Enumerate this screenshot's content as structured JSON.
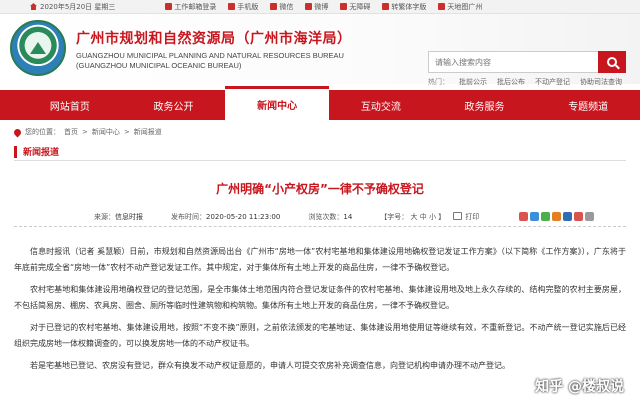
{
  "topbar": {
    "date": "2020年5月20日 星期三",
    "links": [
      {
        "label": "工作邮箱登录",
        "icon": "mail-icon"
      },
      {
        "label": "手机版",
        "icon": "mobile-icon"
      },
      {
        "label": "微信",
        "icon": "wechat-icon"
      },
      {
        "label": "微博",
        "icon": "weibo-icon"
      },
      {
        "label": "无障碍",
        "icon": "accessibility-icon"
      },
      {
        "label": "转繁体字版",
        "icon": "traditional-icon"
      },
      {
        "label": "天地图广州",
        "icon": "map-icon"
      }
    ]
  },
  "header": {
    "title": "广州市规划和自然资源局（广州市海洋局）",
    "en_line1": "GUANGZHOU MUNICIPAL PLANNING AND NATURAL RESOURCES BUREAU",
    "en_line2": "(GUANGZHOU MUNICIPAL OCEANIC BUREAU)",
    "search_placeholder": "请输入搜索内容",
    "hot_label": "热门：",
    "hot_links": [
      "批前公示",
      "批后公布",
      "不动产登记",
      "协助司法查询"
    ]
  },
  "nav": {
    "items": [
      "网站首页",
      "政务公开",
      "新闻中心",
      "互动交流",
      "政务服务",
      "专题频道"
    ],
    "active_index": 2
  },
  "breadcrumb": {
    "prefix": "您的位置：",
    "items": [
      "首页",
      "新闻中心",
      "新闻报道"
    ],
    "separator": ">"
  },
  "section_title": "新闻报道",
  "article": {
    "title": "广州明确“小产权房”一律不予确权登记",
    "source_label": "来源：",
    "source": "信息时报",
    "time_label": "发布时间：",
    "time": "2020-05-20 11:23:00",
    "views_label": "浏览次数：",
    "views": "14",
    "font_label": "【字号：",
    "font_sizes": [
      "大",
      "中",
      "小"
    ],
    "font_end": "】",
    "print_label": "打印",
    "share_colors": [
      "#d9534f",
      "#3a8fd8",
      "#4cae4c",
      "#e67e22",
      "#2f6db5",
      "#d9534f",
      "#999999"
    ],
    "paragraphs": [
      "信息时报讯（记者 奚慧颖）日前，市规划和自然资源局出台《广州市“房地一体”农村宅基地和集体建设用地确权登记发证工作方案》（以下简称《工作方案》），广东将于年底前完成全省“房地一体”农村不动产登记发证工作。其中规定，对于集体所有土地上开发的商品住房，一律不予确权登记。",
      "农村宅基地和集体建设用地确权登记的登记范围，是全市集体土地范围内符合登记发证条件的农村宅基地、集体建设用地及地上永久存续的、结构完整的农村主要房屋，不包括简易房、棚房、农具房、圈舍、厕所等临时性建筑物和构筑物。集体所有土地上开发的商品住房，一律不予确权登记。",
      "对于已登记的农村宅基地、集体建设用地，按照“不变不换”原则，之前依法颁发的宅基地证、集体建设用地使用证等继续有效，不重新登记。不动产统一登记实施后已经组织完成房地一体权籍调查的，可以换发房地一体的不动产权证书。",
      "若是宅基地已登记、农房没有登记，群众有换发不动产权证意愿的，申请人可提交农房补充调查信息，向登记机构申请办理不动产登记。"
    ]
  },
  "watermark": "知乎 @楼叔说"
}
